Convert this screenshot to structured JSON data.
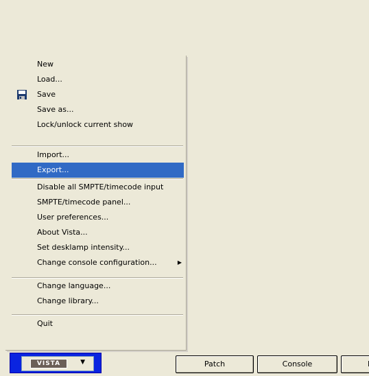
{
  "menu": {
    "items": [
      {
        "label": "New"
      },
      {
        "label": "Load..."
      },
      {
        "label": "Save",
        "icon": "floppy-disk-icon"
      },
      {
        "label": "Save as..."
      },
      {
        "label": "Lock/unlock current show"
      },
      {
        "label": "Import..."
      },
      {
        "label": "Export...",
        "highlighted": true
      },
      {
        "label": "Disable all SMPTE/timecode input"
      },
      {
        "label": "SMPTE/timecode panel..."
      },
      {
        "label": "User preferences..."
      },
      {
        "label": "About Vista..."
      },
      {
        "label": "Set desklamp intensity..."
      },
      {
        "label": "Change console configuration...",
        "submenu_arrow": "▶"
      },
      {
        "label": "Change language..."
      },
      {
        "label": "Change library..."
      },
      {
        "label": "Quit"
      }
    ],
    "highlight_color": "#316ac5"
  },
  "bottombar": {
    "vista_logo": "VISTA",
    "vista_dropdown_icon": "chevron-down-icon",
    "vista_dropdown_arrow": "▼",
    "bar_color": "#0a24e0",
    "buttons": [
      {
        "label": "Patch"
      },
      {
        "label": "Console"
      },
      {
        "label": "F"
      }
    ]
  }
}
